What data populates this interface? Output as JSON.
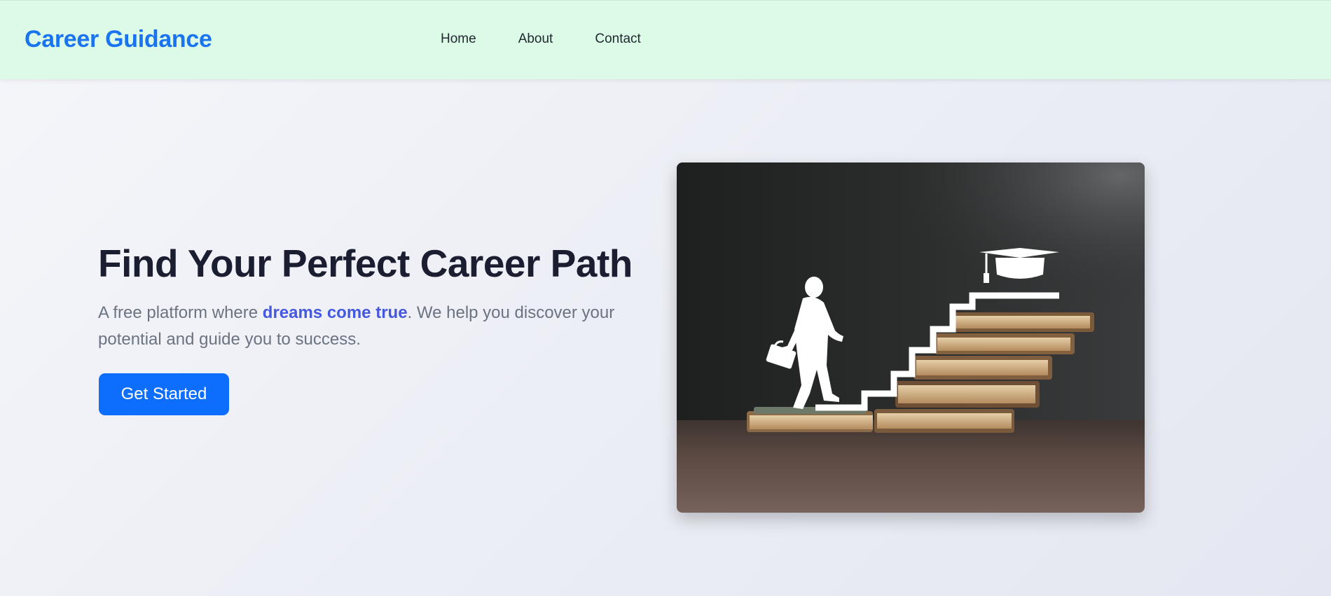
{
  "navbar": {
    "brand": "Career Guidance",
    "links": [
      "Home",
      "About",
      "Contact"
    ],
    "background": "#dbfbe7",
    "brand_color": "#1a73f0"
  },
  "hero": {
    "title": "Find Your Perfect Career Path",
    "text_before": "A free platform where ",
    "highlight": "dreams come true",
    "text_after": ". We help you discover your potential and guide you to success.",
    "button_label": "Get Started",
    "button_color": "#0d6efd",
    "highlight_color": "#4458e0",
    "image_icon": "career-ladder-books-illustration"
  }
}
